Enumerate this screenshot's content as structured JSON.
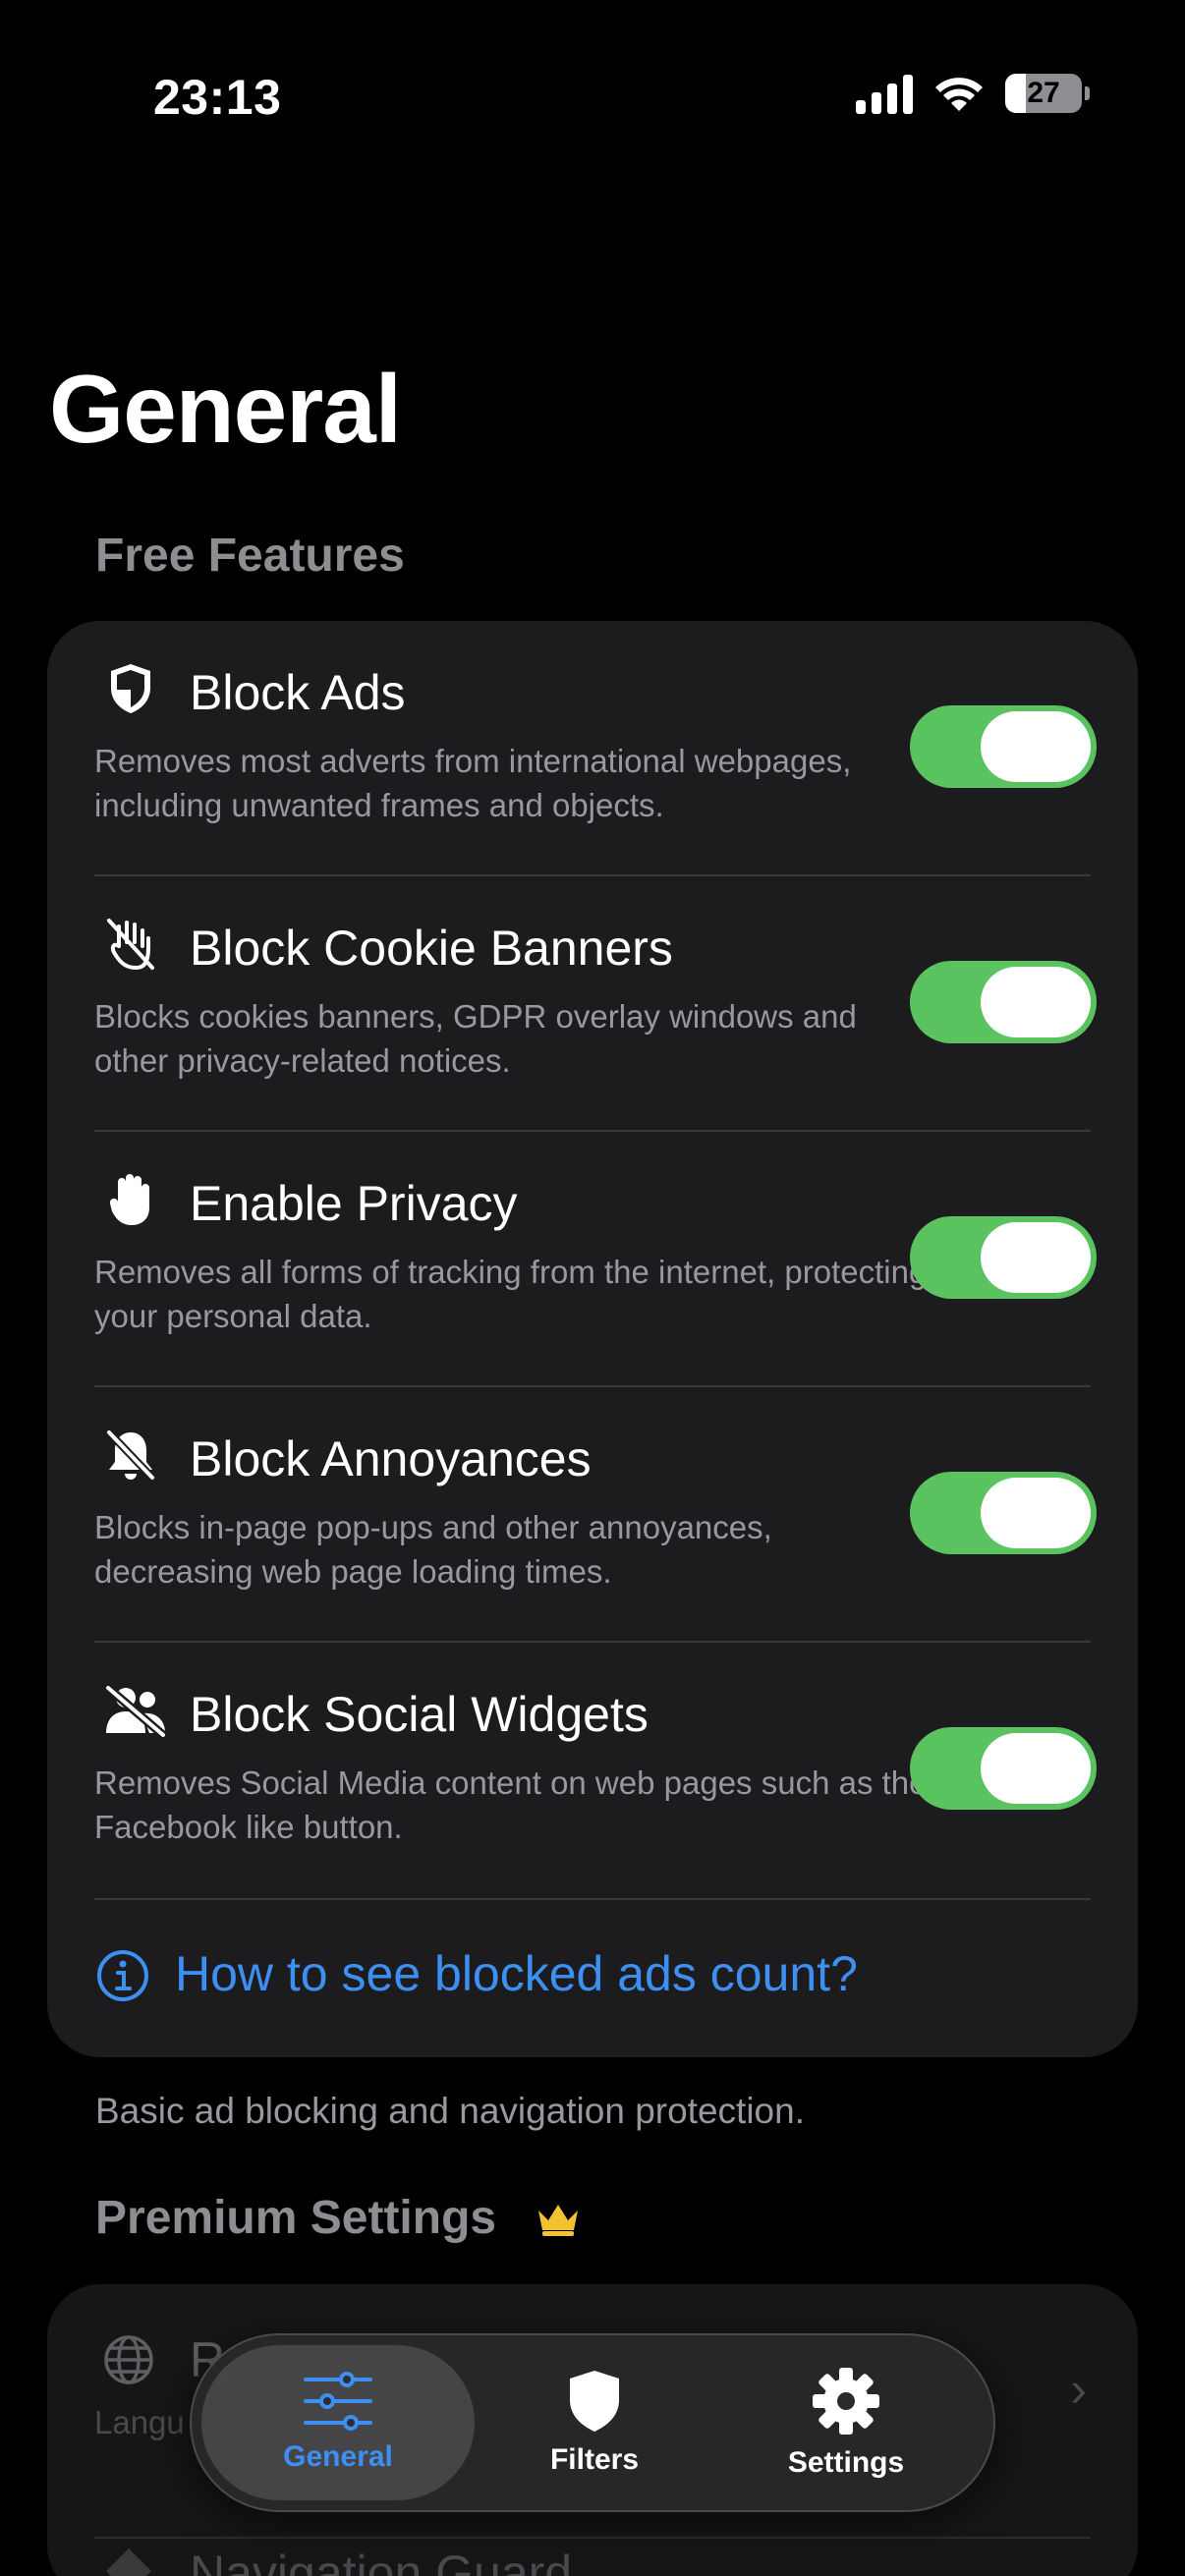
{
  "status": {
    "time": "23:13",
    "battery": "27",
    "battery_level_percent": 27
  },
  "page_title": "General",
  "free_section": {
    "header": "Free Features",
    "items": [
      {
        "icon": "shield-icon",
        "title": "Block Ads",
        "description": "Removes most adverts from international webpages, including unwanted frames and objects.",
        "enabled": true
      },
      {
        "icon": "hand-cookie-icon",
        "title": "Block Cookie Banners",
        "description": "Blocks cookies banners, GDPR overlay windows and other privacy-related notices.",
        "enabled": true
      },
      {
        "icon": "raised-hand-icon",
        "title": "Enable Privacy",
        "description": "Removes all forms of tracking from the internet, protecting your personal data.",
        "enabled": true
      },
      {
        "icon": "bell-slash-icon",
        "title": "Block Annoyances",
        "description": "Blocks in-page pop-ups and other annoyances, decreasing web page loading times.",
        "enabled": true
      },
      {
        "icon": "people-slash-icon",
        "title": "Block Social Widgets",
        "description": "Removes Social Media content on web pages such as the Facebook like button.",
        "enabled": true
      }
    ],
    "help_link": "How to see blocked ads count?",
    "footer": "Basic ad blocking and navigation protection."
  },
  "premium_section": {
    "header": "Premium Settings",
    "items": [
      {
        "icon": "globe-icon",
        "title": "R",
        "subtitle": "Langu"
      },
      {
        "icon": "navigation-guard-icon",
        "title": "Navigation Guard"
      }
    ]
  },
  "tabs": [
    {
      "label": "General",
      "icon": "sliders-icon",
      "active": true
    },
    {
      "label": "Filters",
      "icon": "shield-tab-icon",
      "active": false
    },
    {
      "label": "Settings",
      "icon": "gear-icon",
      "active": false
    }
  ],
  "colors": {
    "accent": "#3d8ff2",
    "toggle_on": "#5ac25e",
    "card": "#1c1c1e"
  }
}
